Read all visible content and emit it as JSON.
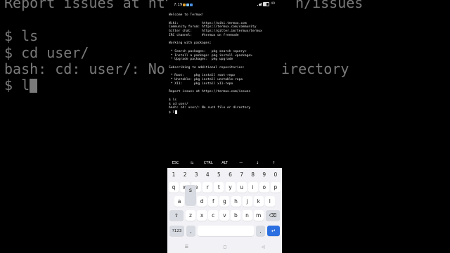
{
  "background_terminal": {
    "lines": [
      "Report issues at htt",
      "$ ls",
      "$ cd user/",
      "bash: cd: user/: No",
      "$ l"
    ],
    "right_fragments": [
      "n/issues",
      "irectory"
    ]
  },
  "status_bar": {
    "time": "7:19",
    "notification_colors": [
      "#e0a030",
      "#7fc4ff",
      "#4a90e2"
    ],
    "battery": "49",
    "battery_level": 0.49
  },
  "terminal": {
    "lines": [
      "Welcome to Termux!",
      "",
      "Wiki:            https://wiki.termux.com",
      "Community forum: https://termux.com/community",
      "Gitter chat:     https://gitter.im/termux/termux",
      "IRC channel:     #termux on freenode",
      "",
      "Working with packages:",
      "",
      " * Search packages:   pkg search <query>",
      " * Install a package: pkg install <package>",
      " * Upgrade packages:  pkg upgrade",
      "",
      "Subscribing to additional repositories:",
      "",
      " * Root:     pkg install root-repo",
      " * Unstable: pkg install unstable-repo",
      " * X11:      pkg install x11-repo",
      "",
      "Report issues at https://termux.com/issues",
      "",
      "$ ls",
      "$ cd user/",
      "bash: cd: user/: No such file or directory",
      "$ l"
    ]
  },
  "extra_keys": [
    "ESC",
    "⇆",
    "CTRL",
    "ALT",
    "—",
    "↓",
    "↑"
  ],
  "keyboard": {
    "number_row": [
      "1",
      "2",
      "3",
      "4",
      "5",
      "6",
      "7",
      "8",
      "9",
      "0"
    ],
    "row1": [
      "q",
      "w",
      "e",
      "r",
      "t",
      "y",
      "u",
      "i",
      "o",
      "p"
    ],
    "row2": [
      "a",
      "s",
      "d",
      "f",
      "g",
      "h",
      "j",
      "k",
      "l"
    ],
    "row3": [
      "z",
      "x",
      "c",
      "v",
      "b",
      "n",
      "m"
    ],
    "shift": "⇧",
    "backspace": "⌫",
    "symbols": "?123",
    "comma": ",",
    "period": ".",
    "enter": "↵",
    "popup_letter": "s"
  },
  "nav_bar": {
    "menu": "☰",
    "home": "◻",
    "back": "◁"
  }
}
